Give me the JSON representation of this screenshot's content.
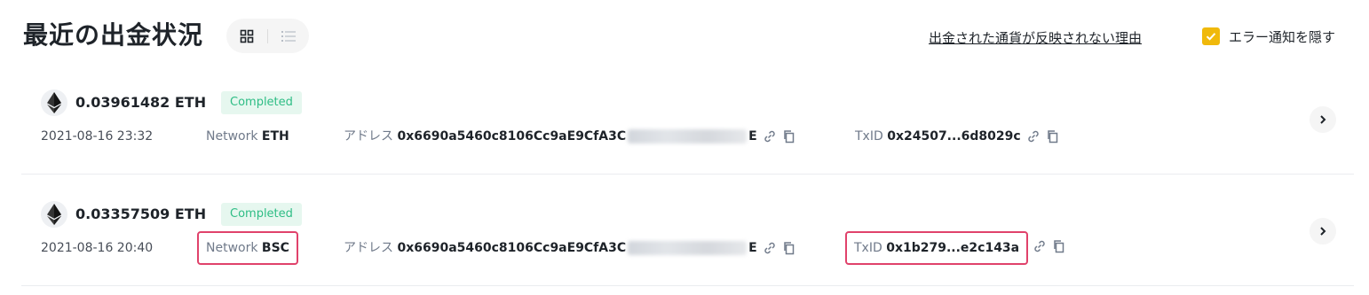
{
  "header": {
    "title": "最近の出金状況",
    "reason_link": "出金された通貨が反映されない理由",
    "hide_errors_label": "エラー通知を隠す",
    "hide_errors_checked": true
  },
  "colors": {
    "accent": "#f0b90b",
    "completed_text": "#2ebd85",
    "completed_bg": "#e6f7ef",
    "highlight": "#e0426b"
  },
  "labels": {
    "network": "Network",
    "address": "アドレス",
    "txid": "TxID"
  },
  "rows": [
    {
      "icon": "ethereum-icon",
      "amount": "0.03961482 ETH",
      "status": "Completed",
      "datetime": "2021-08-16 23:32",
      "network": "ETH",
      "address_start": "0x6690a5460c8106Cc9aE9CfA3C",
      "address_end": "E",
      "txid": "0x24507...6d8029c"
    },
    {
      "icon": "ethereum-icon",
      "amount": "0.03357509 ETH",
      "status": "Completed",
      "datetime": "2021-08-16 20:40",
      "network": "BSC",
      "address_start": "0x6690a5460c8106Cc9aE9CfA3C",
      "address_end": "E",
      "txid": "0x1b279...e2c143a"
    }
  ]
}
